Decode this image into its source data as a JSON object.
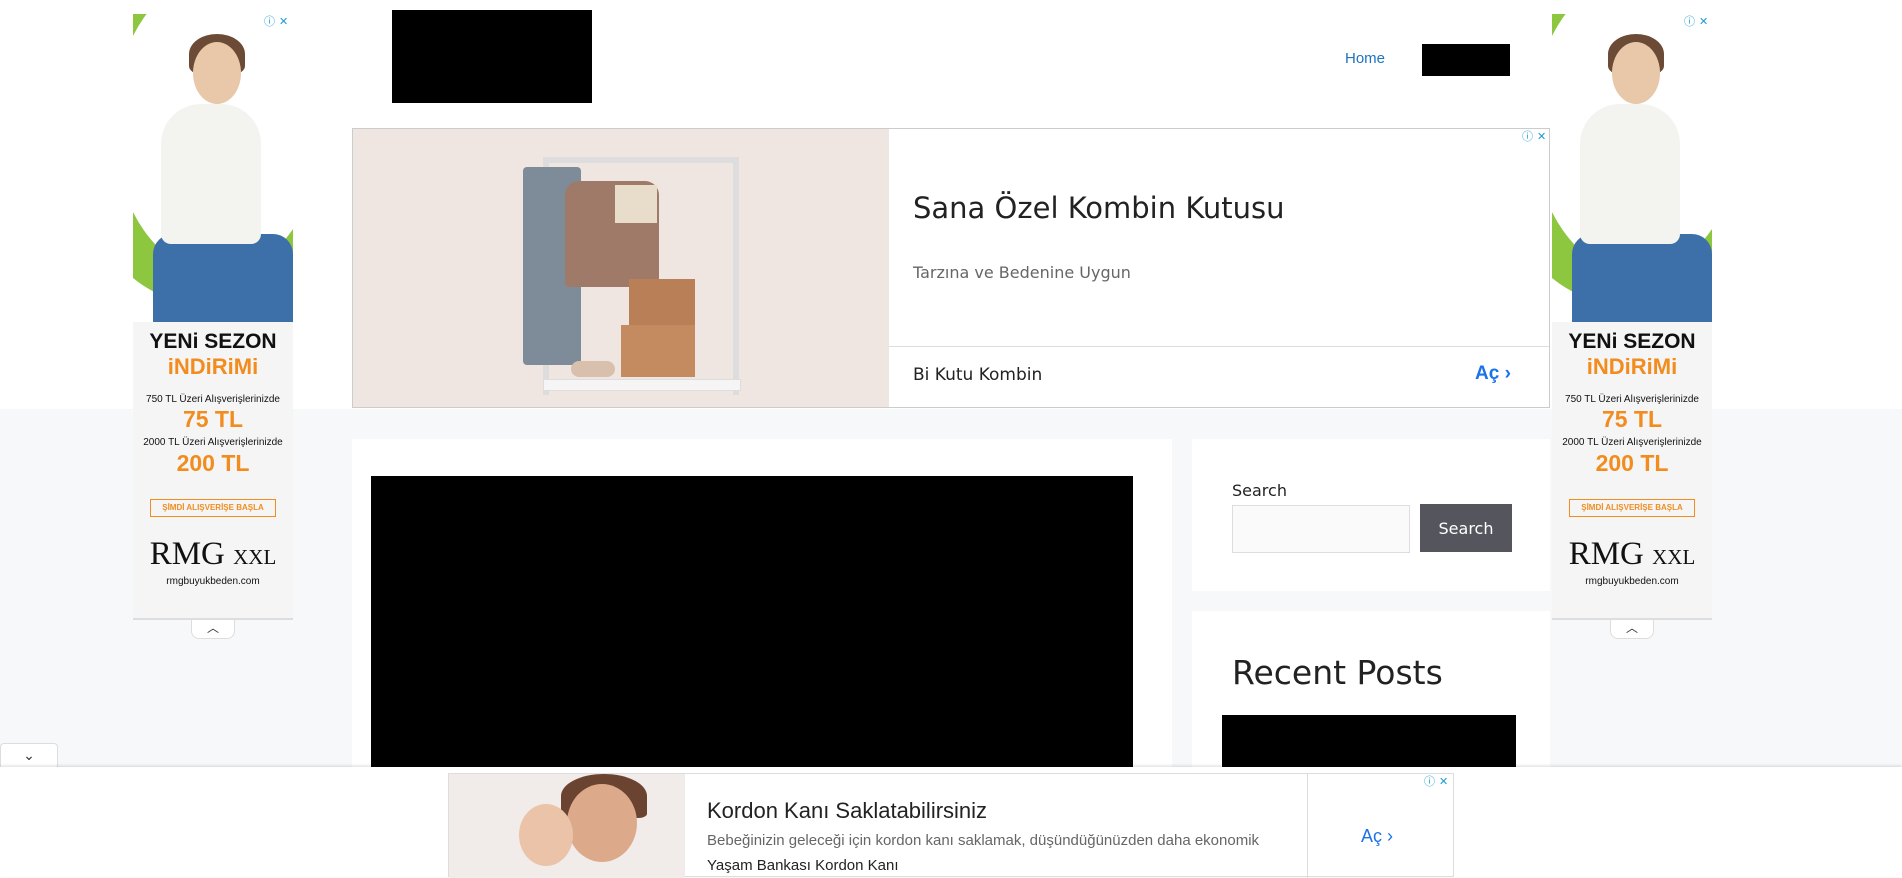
{
  "header": {
    "nav_home": "Home"
  },
  "side_ad": {
    "headline_1": "YENi SEZON",
    "headline_2": "iNDiRiMi",
    "tier_1": "750 TL Üzeri Alışverişlerinizde",
    "amount_1": "75 TL",
    "tier_2": "2000 TL Üzeri Alışverişlerinizde",
    "amount_2": "200 TL",
    "cta": "ŞİMDİ ALIŞVERİŞE BAŞLA",
    "brand_main": "RMG",
    "brand_sub": "XXL",
    "domain": "rmgbuyukbeden.com",
    "adchoice_glyph": "ⓘ",
    "close_glyph": "✕",
    "collapse_glyph": "︿"
  },
  "top_ad": {
    "title": "Sana Özel Kombin Kutusu",
    "description": "Tarzına ve Bedenine Uygun",
    "advertiser": "Bi Kutu Kombin",
    "open_label": "Aç ›"
  },
  "sidebar": {
    "search_label": "Search",
    "search_value": "",
    "search_button": "Search",
    "recent_posts_title": "Recent Posts"
  },
  "anchor_ad": {
    "collapse_glyph": "⌄",
    "title": "Kordon Kanı Saklatabilirsiniz",
    "description": "Bebeğinizin geleceği için kordon kanı saklamak, düşündüğünüzden daha ekonomik",
    "advertiser": "Yaşam Bankası Kordon Kanı",
    "open_label": "Aç ›"
  },
  "colors": {
    "link_blue": "#1e73be",
    "ad_open_blue": "#1a73e8",
    "promo_orange": "#f28c1e",
    "search_button_bg": "#55555e",
    "page_bg": "#f7f8f9"
  }
}
